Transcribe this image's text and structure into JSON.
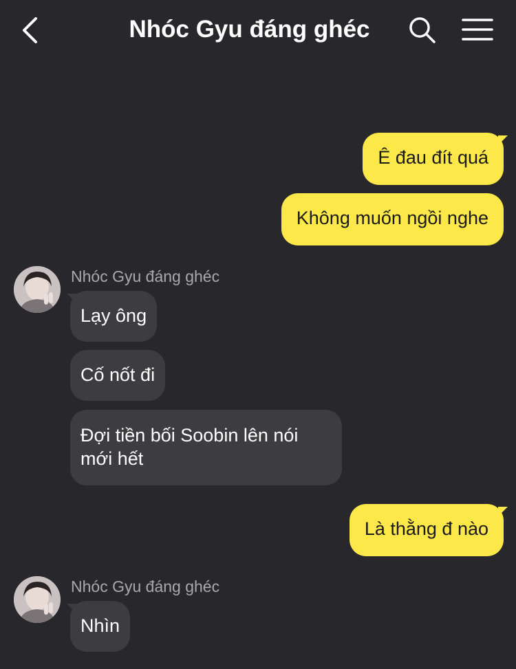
{
  "header": {
    "title": "Nhóc Gyu đáng ghéc",
    "back_icon": "chevron-left-icon",
    "search_icon": "search-icon",
    "menu_icon": "hamburger-menu-icon"
  },
  "colors": {
    "background": "#28282c",
    "my_bubble": "#fde84a",
    "other_bubble": "#3d3d41",
    "sender_name": "#a9a9ad"
  },
  "messages": [
    {
      "from": "me",
      "text": "Ê đau đít quá"
    },
    {
      "from": "me",
      "text": "Không muốn ngồi nghe"
    },
    {
      "from": "other",
      "sender": "Nhóc Gyu đáng ghéc",
      "text": "Lạy ông"
    },
    {
      "from": "other",
      "text": "Cố nốt đi"
    },
    {
      "from": "other",
      "text": "Đợi tiền bối Soobin lên nói mới hết"
    },
    {
      "from": "me",
      "text": "Là thằng đ nào"
    },
    {
      "from": "other",
      "sender": "Nhóc Gyu đáng ghéc",
      "text": "Nhìn"
    }
  ]
}
